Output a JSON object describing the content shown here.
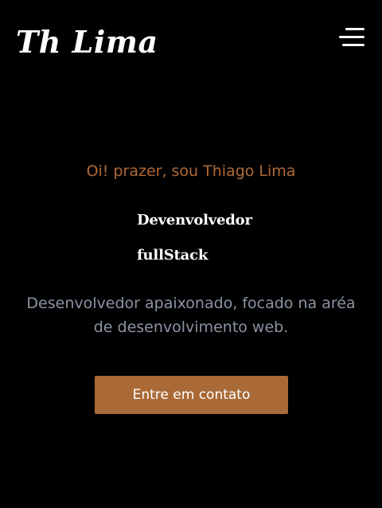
{
  "header": {
    "logo_text": "Th Lima",
    "menu_icon": "hamburger-menu-icon"
  },
  "hero": {
    "greeting": "Oi! prazer, sou Thiago Lima",
    "role_line_1": "Devenvolvedor",
    "role_line_2": "fullStack",
    "description": "Desenvolvedor apaixonado, focado na aréa de desenvolvimento web.",
    "cta_label": "Entre em contato"
  },
  "colors": {
    "background": "#000000",
    "accent": "#b06a36",
    "button": "#a96a37",
    "muted_text": "#8b94a2"
  }
}
